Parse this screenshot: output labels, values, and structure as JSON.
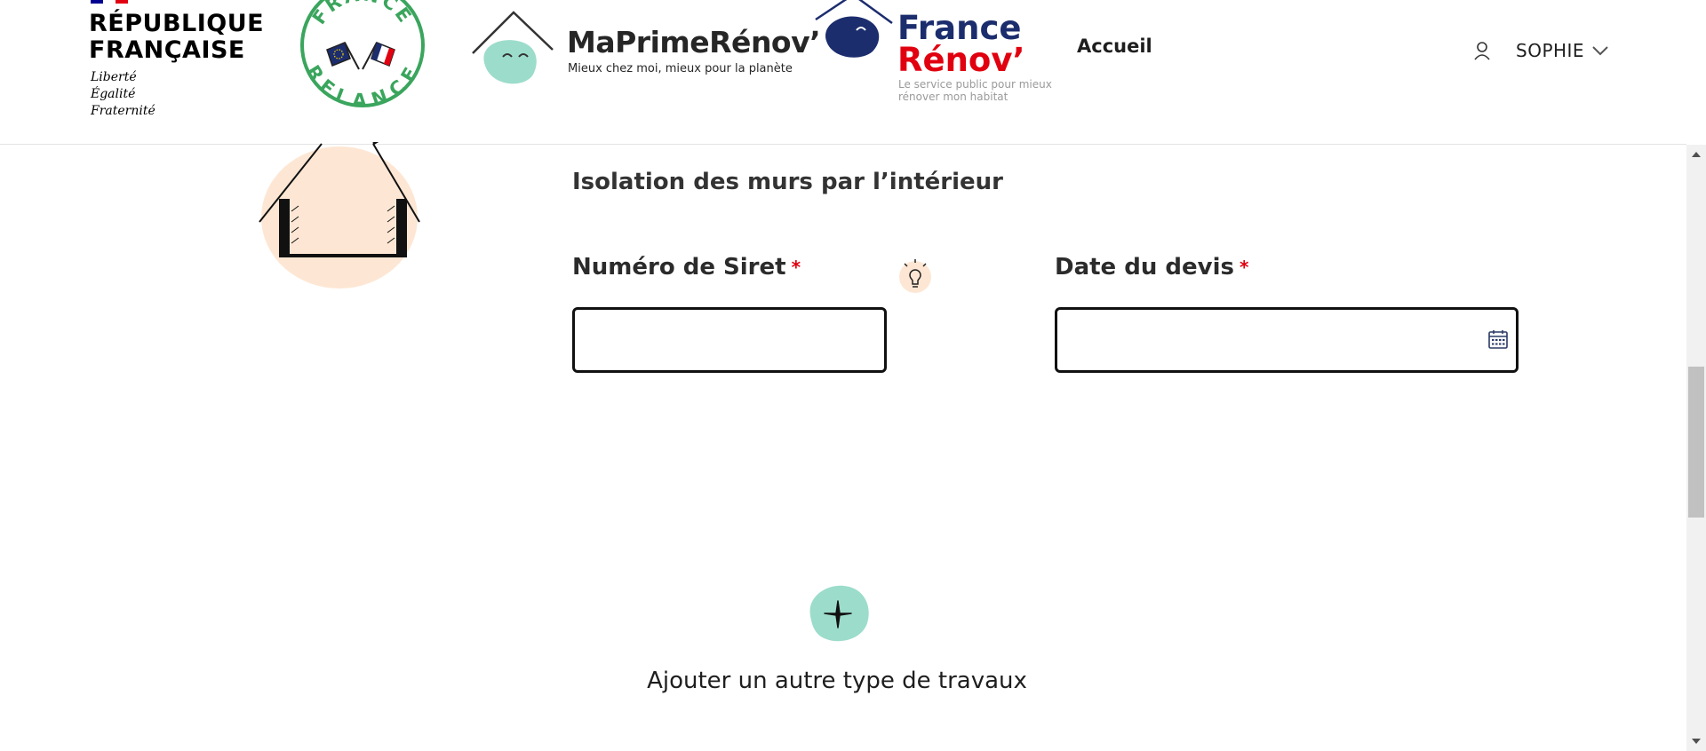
{
  "header": {
    "rf_flag_colors": [
      "#000091",
      "#ffffff",
      "#e1000f"
    ],
    "rf_title": [
      "RÉPUBLIQUE",
      "FRANÇAISE"
    ],
    "rf_motto": [
      "Liberté",
      "Égalité",
      "Fraternité"
    ],
    "relance_logo": {
      "top": "FRANCE",
      "bottom": "RELANCE",
      "color": "#3aa55d"
    },
    "maprimerenov": {
      "name": "MaPrimeRénov’",
      "tagline": "Mieux chez moi, mieux pour la planète",
      "blob_color": "#9cdccb"
    },
    "france_renov": {
      "line1": "France",
      "line2": "Rénov’",
      "tagline": "Le service public pour mieux rénover mon habitat",
      "blue": "#1c2d6e",
      "red": "#e1000f"
    },
    "nav": {
      "accueil": "Accueil"
    },
    "user": {
      "name": "SOPHIE",
      "icon": "user-icon",
      "chevron": "chevron-down-icon"
    }
  },
  "form": {
    "work_type_title": "Isolation des murs par l’intérieur",
    "fields": [
      {
        "label": "Numéro de Siret",
        "required_marker": "*",
        "value": ""
      },
      {
        "label": "Date du devis",
        "required_marker": "*",
        "value": "",
        "icon": "calendar-icon"
      }
    ],
    "hint_icon": "lightbulb-icon"
  },
  "add_work": {
    "label": "Ajouter un autre type de travaux",
    "icon": "plus-icon",
    "blob_color": "#9cdccb"
  },
  "colors": {
    "accent_required": "#e1000f",
    "house_blob": "#fde7d4"
  }
}
